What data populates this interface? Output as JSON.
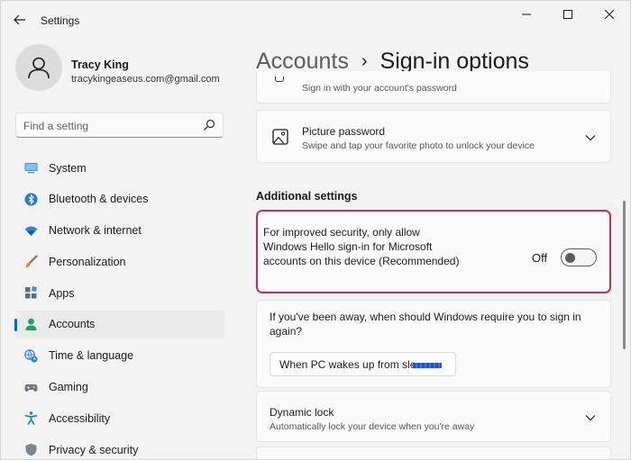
{
  "window": {
    "app_title": "Settings",
    "controls": [
      "minimize",
      "maximize",
      "close"
    ]
  },
  "profile": {
    "name": "Tracy King",
    "email": "tracykingeaseus.com@gmail.com"
  },
  "search": {
    "placeholder": "Find a setting"
  },
  "sidebar": {
    "items": [
      {
        "label": "System",
        "icon": "system-icon",
        "active": false
      },
      {
        "label": "Bluetooth & devices",
        "icon": "bluetooth-icon",
        "active": false
      },
      {
        "label": "Network & internet",
        "icon": "wifi-icon",
        "active": false
      },
      {
        "label": "Personalization",
        "icon": "brush-icon",
        "active": false
      },
      {
        "label": "Apps",
        "icon": "apps-icon",
        "active": false
      },
      {
        "label": "Accounts",
        "icon": "person-icon",
        "active": true
      },
      {
        "label": "Time & language",
        "icon": "globe-clock-icon",
        "active": false
      },
      {
        "label": "Gaming",
        "icon": "gamepad-icon",
        "active": false
      },
      {
        "label": "Accessibility",
        "icon": "accessibility-icon",
        "active": false
      },
      {
        "label": "Privacy & security",
        "icon": "shield-icon",
        "active": false
      }
    ]
  },
  "breadcrumb": {
    "parent": "Accounts",
    "separator": "›",
    "current": "Sign-in options"
  },
  "cards": {
    "password_partial": {
      "description": "Sign in with your account's password"
    },
    "picture_password": {
      "title": "Picture password",
      "description": "Swipe and tap your favorite photo to unlock your device"
    }
  },
  "additional_settings": {
    "heading": "Additional settings",
    "windows_hello_only": {
      "text": "For improved security, only allow Windows Hello sign-in for Microsoft accounts on this device (Recommended)",
      "state_label": "Off",
      "enabled": false
    },
    "require_signin": {
      "question": "If you've been away, when should Windows require you to sign in again?",
      "selected": "When PC wakes up from sle"
    },
    "dynamic_lock": {
      "title": "Dynamic lock",
      "description": "Automatically lock your device when you're away"
    }
  },
  "colors": {
    "accent": "#0067c0",
    "highlight_border": "#d52a4a",
    "window_bg": "#f3f3f3",
    "card_bg": "#fbfbfb"
  }
}
